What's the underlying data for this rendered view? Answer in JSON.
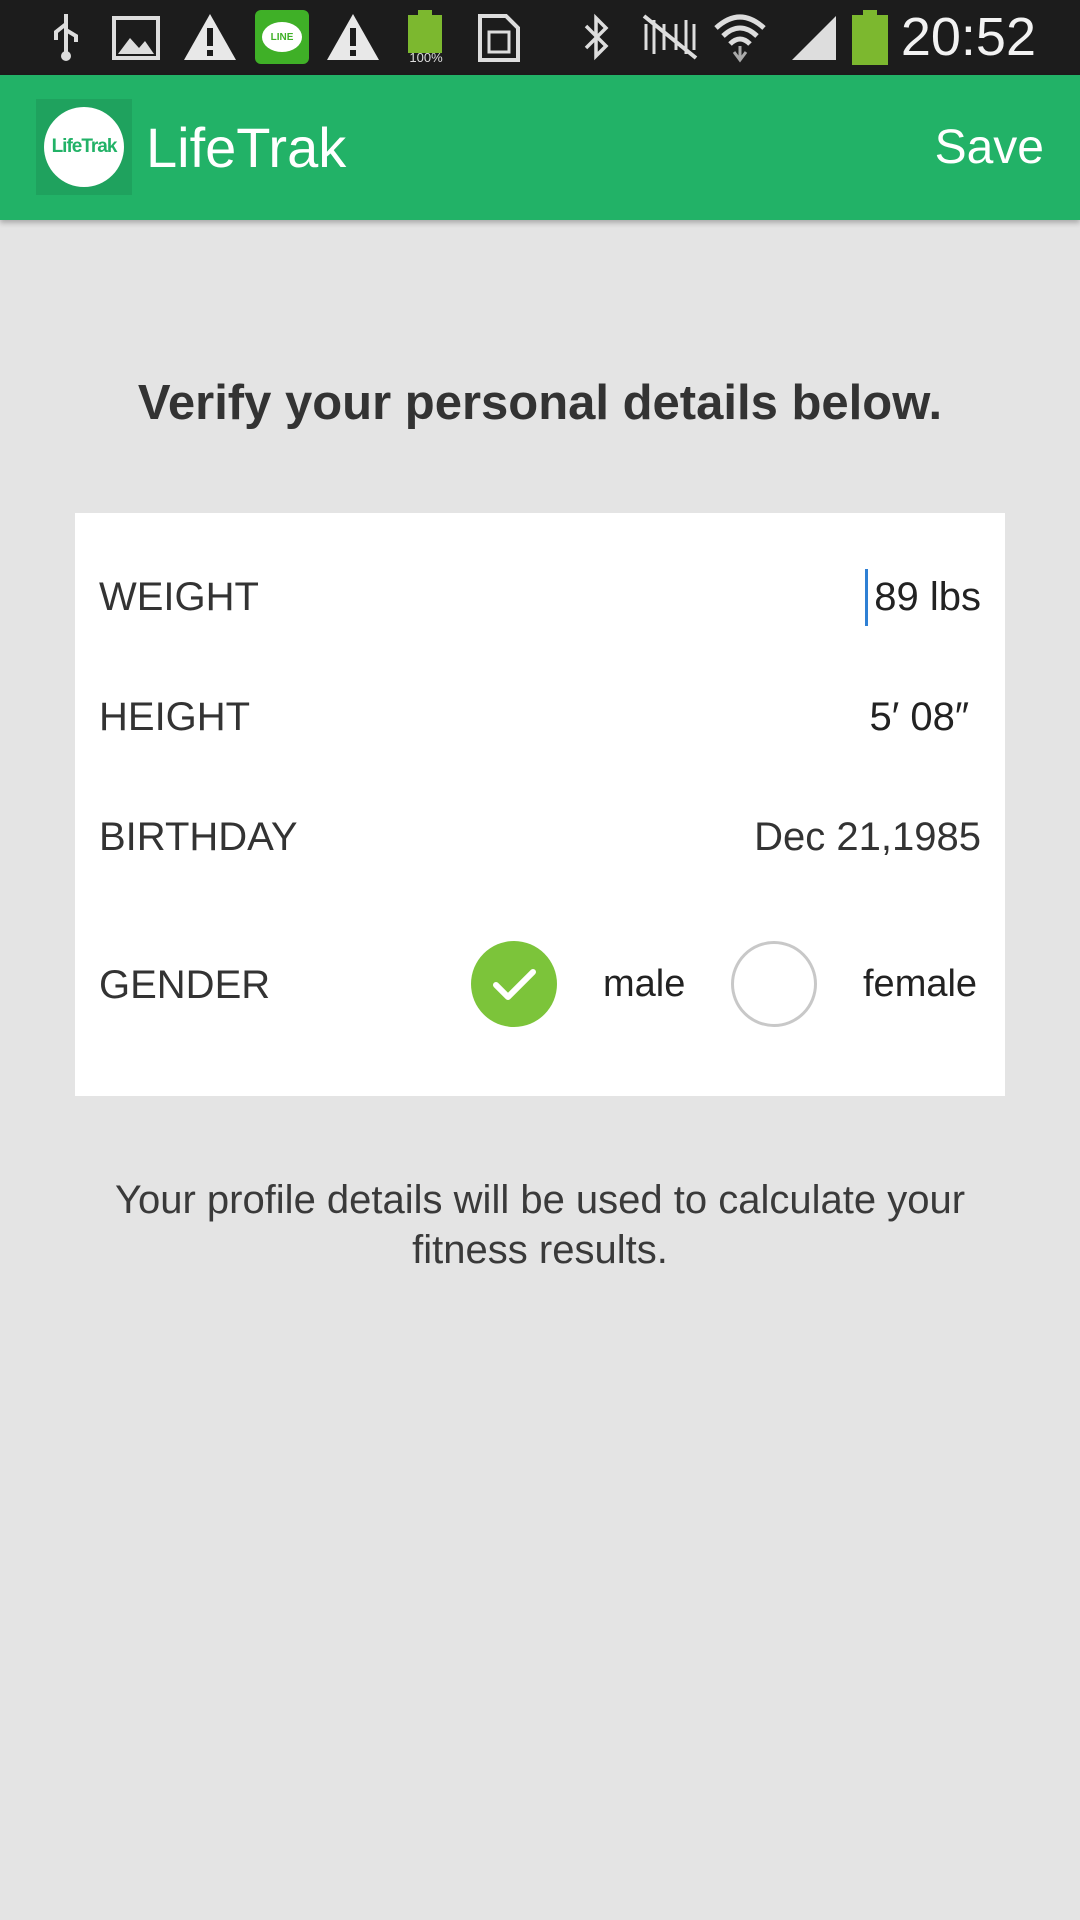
{
  "status_bar": {
    "time": "20:52",
    "battery_small_label": "100%",
    "line_label": "LINE"
  },
  "app_bar": {
    "logo_text": "LifeTrak",
    "title": "LifeTrak",
    "save_label": "Save"
  },
  "heading": "Verify your personal details below.",
  "form": {
    "weight": {
      "label": "WEIGHT",
      "value": "89 lbs"
    },
    "height": {
      "label": "HEIGHT",
      "value": "5′ 08″"
    },
    "birthday": {
      "label": "BIRTHDAY",
      "value": "Dec 21,1985"
    },
    "gender": {
      "label": "GENDER",
      "options": [
        {
          "label": "male",
          "selected": true
        },
        {
          "label": "female",
          "selected": false
        }
      ]
    }
  },
  "note": "Your profile details will be used to calculate your fitness results.",
  "colors": {
    "accent": "#22b267",
    "check": "#7cc43a",
    "background": "#e4e4e4"
  }
}
